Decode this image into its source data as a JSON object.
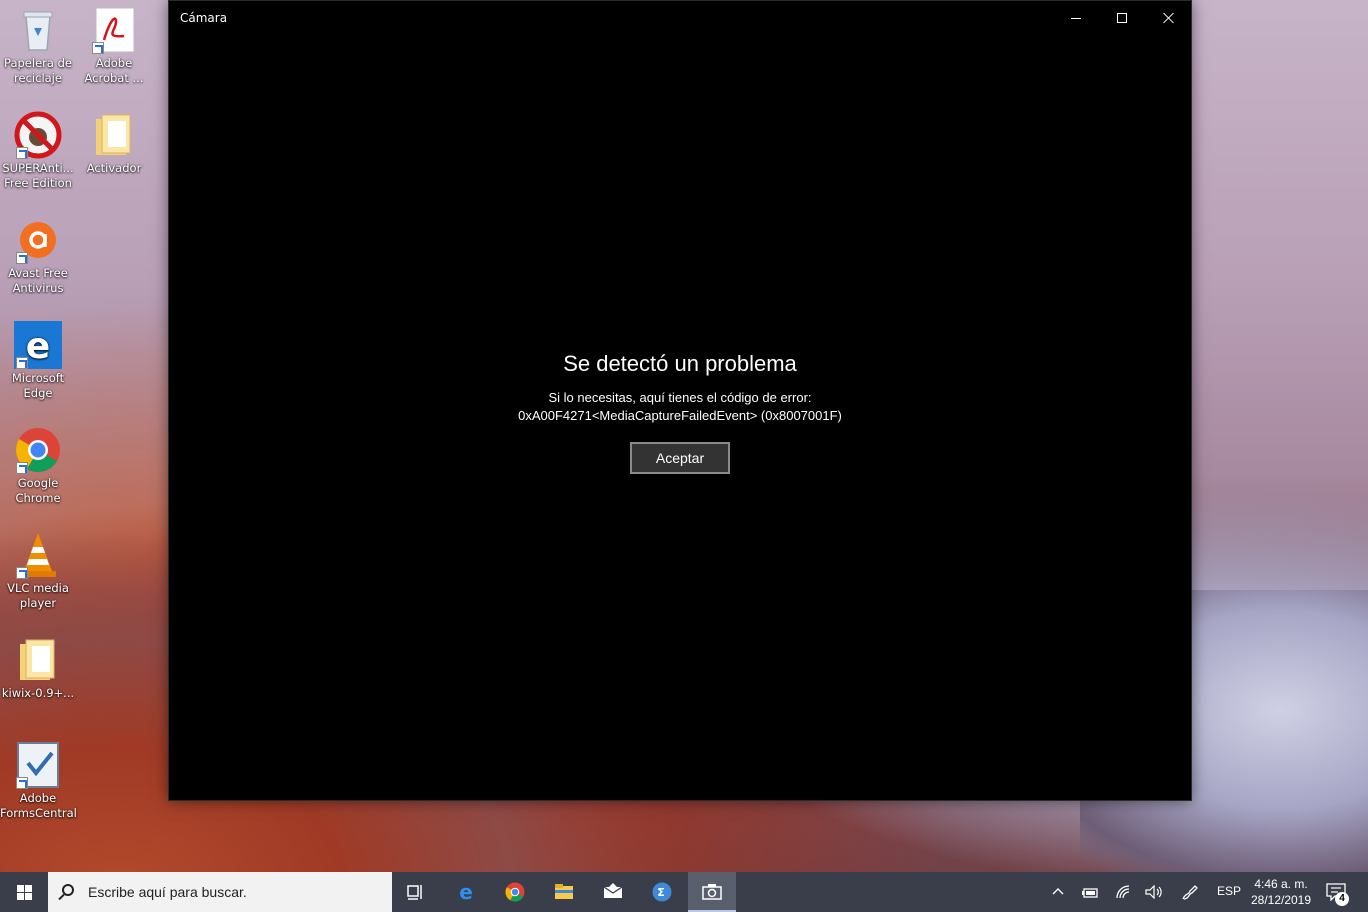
{
  "desktop": {
    "icons": [
      {
        "label_line1": "Papelera de",
        "label_line2": "reciclaje"
      },
      {
        "label_line1": "Adobe",
        "label_line2": "Acrobat ..."
      },
      {
        "label_line1": "SUPERAnti...",
        "label_line2": "Free Edition"
      },
      {
        "label_line1": "Activador",
        "label_line2": ""
      },
      {
        "label_line1": "Avast Free",
        "label_line2": "Antivirus"
      },
      {
        "label_line1": "Microsoft",
        "label_line2": "Edge"
      },
      {
        "label_line1": "Google",
        "label_line2": "Chrome"
      },
      {
        "label_line1": "VLC media",
        "label_line2": "player"
      },
      {
        "label_line1": "kiwix-0.9+...",
        "label_line2": ""
      },
      {
        "label_line1": "Adobe",
        "label_line2": "FormsCentral"
      }
    ]
  },
  "window": {
    "title": "Cámara",
    "error": {
      "title": "Se detectó un problema",
      "line1": "Si lo necesitas, aquí tienes el código de error:",
      "line2": "0xA00F4271<MediaCaptureFailedEvent> (0x8007001F)",
      "button": "Aceptar"
    }
  },
  "taskbar": {
    "search_placeholder": "Escribe aquí para buscar.",
    "language": "ESP",
    "time": "4:46 a. m.",
    "date": "28/12/2019",
    "notification_count": "4",
    "apps": [
      "task-view",
      "edge",
      "chrome",
      "file-explorer",
      "mail",
      "calculator-app",
      "camera"
    ]
  },
  "colors": {
    "window_bg": "#000000",
    "taskbar_bg": "#3a3e4a",
    "accent": "#0078d7"
  }
}
